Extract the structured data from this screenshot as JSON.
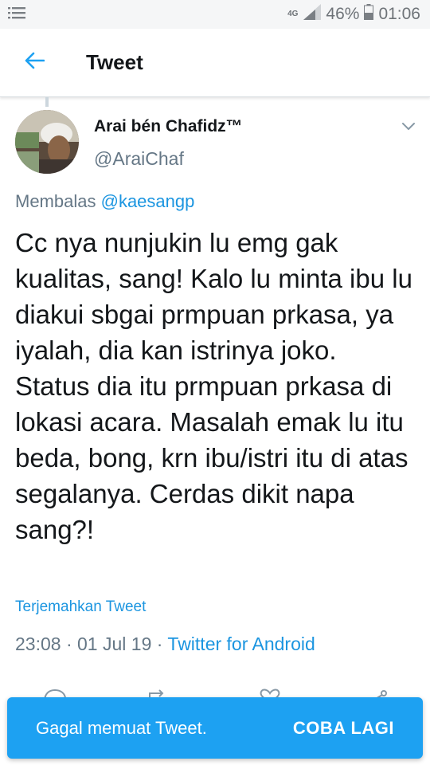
{
  "status_bar": {
    "network_label": "4G",
    "battery": "46%",
    "time": "01:06",
    "icons": [
      "notification-list-icon",
      "signal-icon",
      "battery-icon"
    ]
  },
  "app_bar": {
    "title": "Tweet",
    "back_icon": "arrow-left-icon",
    "accent": "#1da1f2"
  },
  "tweet": {
    "author_name": "Arai bén Chafidz™",
    "author_handle": "@AraiChaf",
    "reply_prefix": "Membalas",
    "reply_mention": "@kaesangp",
    "text": "Cc nya nunjukin lu emg gak kualitas, sang! Kalo lu minta ibu lu diakui sbgai prmpuan prkasa, ya iyalah, dia kan istrinya joko. Status dia itu prmpuan prkasa di lokasi acara. Masalah emak lu itu beda, bong, krn ibu/istri itu di atas segalanya. Cerdas dikit napa sang?!",
    "translate_label": "Terjemahkan Tweet",
    "time": "23:08",
    "date": "01 Jul 19",
    "separator": "·",
    "source": "Twitter for Android"
  },
  "snackbar": {
    "message": "Gagal memuat Tweet.",
    "action": "COBA LAGI",
    "background": "#1da1f2"
  },
  "colors": {
    "link": "#1b95e0",
    "secondary_text": "#657786",
    "primary_text": "#14171a"
  }
}
